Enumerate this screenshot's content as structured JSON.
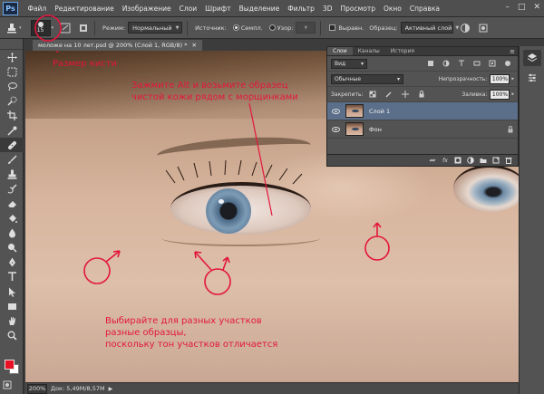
{
  "app": {
    "logo": "Ps"
  },
  "menu": [
    "Файл",
    "Редактирование",
    "Изображение",
    "Слои",
    "Шрифт",
    "Выделение",
    "Фильтр",
    "3D",
    "Просмотр",
    "Окно",
    "Справка"
  ],
  "window_controls": {
    "minimize": "–",
    "maximize": "□",
    "close": "✕"
  },
  "options": {
    "brush_size": "15",
    "mode_label": "Режим:",
    "mode_value": "Нормальный",
    "source_label": "Источник:",
    "source_option_sample": "Семпл.",
    "source_option_pattern": "Узор:",
    "aligned_label": "Выравн.",
    "sample_label": "Образец:",
    "sample_value": "Активный слой"
  },
  "document": {
    "tab_title": "моложе на 10 лет.psd @ 200% (Слой 1, RGB/8) *",
    "close": "✕"
  },
  "annotations": {
    "brush_size_note": "Размер кисти",
    "alt_note_line1": "Зажмите Alt и возьмите образец",
    "alt_note_line2": "чистой кожи рядом с морщинками",
    "areas_note_line1": "Выбирайте для разных участков",
    "areas_note_line2": "разные образцы,",
    "areas_note_line3": "поскольку тон участков отличается"
  },
  "layers_panel": {
    "tabs": [
      "Слои",
      "Каналы",
      "История"
    ],
    "filter_kind": "Вид",
    "blend_mode": "Обычные",
    "opacity_label": "Непрозрачность:",
    "opacity_value": "100%",
    "lock_label": "Закрепить:",
    "fill_label": "Заливка:",
    "fill_value": "100%",
    "layers": [
      {
        "name": "Слой 1",
        "selected": true
      },
      {
        "name": "Фон",
        "selected": false
      }
    ],
    "footer_icons": [
      "link-icon",
      "fx-icon",
      "mask-icon",
      "adjustment-icon",
      "folder-icon",
      "new-layer-icon",
      "trash-icon"
    ]
  },
  "status": {
    "zoom": "200%",
    "doc_size": "Док: 5,49M/8,57M"
  },
  "colors": {
    "accent_red": "#e3163b",
    "fg_swatch": "#e81124",
    "bg_swatch": "#ffffff",
    "selected_layer": "#5b6f8a"
  }
}
